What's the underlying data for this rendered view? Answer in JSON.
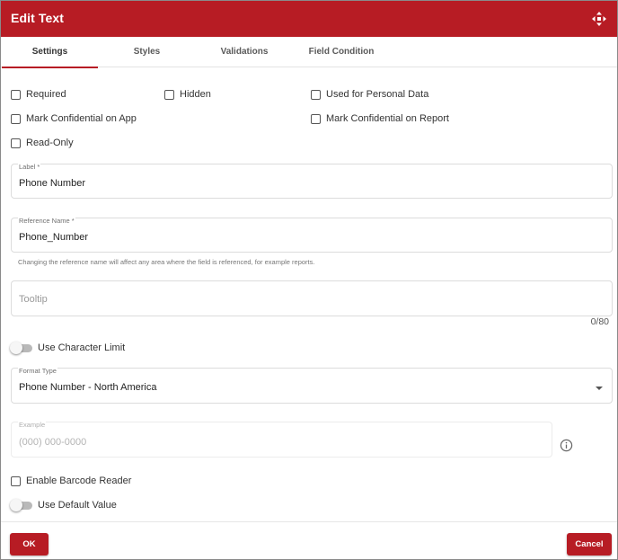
{
  "dialog": {
    "title": "Edit Text",
    "accent_color": "#b71c24"
  },
  "tabs": [
    {
      "label": "Settings",
      "active": true
    },
    {
      "label": "Styles",
      "active": false
    },
    {
      "label": "Validations",
      "active": false
    },
    {
      "label": "Field Condition",
      "active": false
    }
  ],
  "checkboxes": {
    "required": {
      "label": "Required",
      "checked": false
    },
    "hidden": {
      "label": "Hidden",
      "checked": false
    },
    "personal_data": {
      "label": "Used for Personal Data",
      "checked": false
    },
    "confidential_app": {
      "label": "Mark Confidential on App",
      "checked": false
    },
    "confidential_report": {
      "label": "Mark Confidential on Report",
      "checked": false
    },
    "read_only": {
      "label": "Read-Only",
      "checked": false
    },
    "barcode": {
      "label": "Enable Barcode Reader",
      "checked": false
    }
  },
  "fields": {
    "label": {
      "label": "Label *",
      "value": "Phone Number"
    },
    "reference": {
      "label": "Reference Name *",
      "value": "Phone_Number",
      "hint": "Changing the reference name will affect any area where the field is referenced, for example reports."
    },
    "tooltip": {
      "placeholder": "Tooltip",
      "counter": "0/80"
    },
    "format": {
      "label": "Format Type",
      "value": "Phone Number - North America"
    },
    "example": {
      "label": "Example",
      "placeholder": "(000) 000-0000"
    }
  },
  "toggles": {
    "char_limit": {
      "label": "Use Character Limit",
      "on": false
    },
    "default_value": {
      "label": "Use Default Value",
      "on": false
    }
  },
  "footer": {
    "ok_label": "OK",
    "cancel_label": "Cancel"
  },
  "icons": {
    "move": "move-arrows-icon",
    "info": "info-icon",
    "dropdown": "chevron-down-icon"
  }
}
